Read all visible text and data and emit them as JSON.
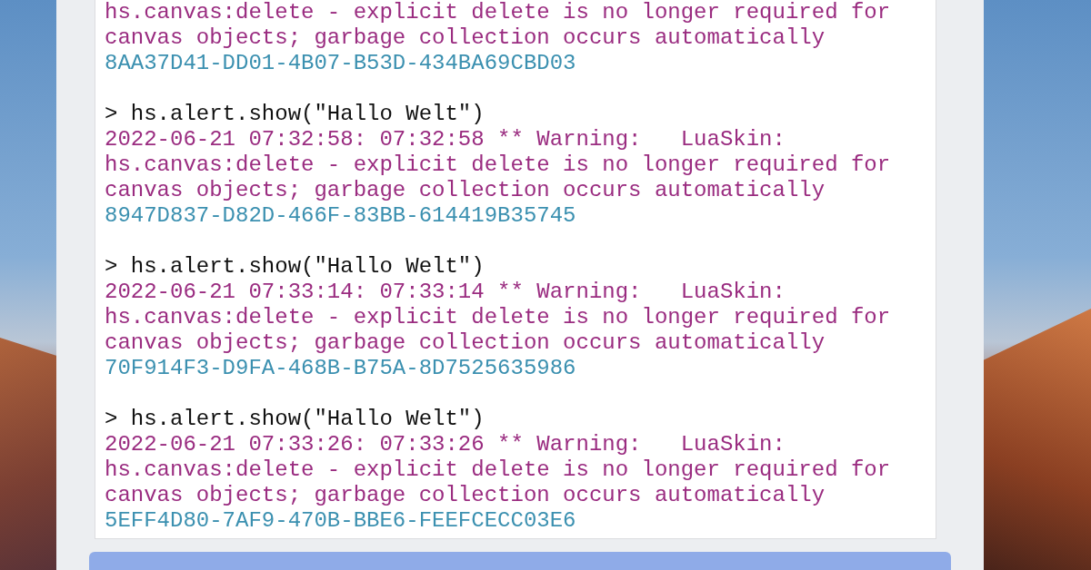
{
  "console": {
    "blocks": [
      {
        "lines": [
          {
            "kind": "warning",
            "text": "hs.canvas:delete - explicit delete is no longer required for"
          },
          {
            "kind": "warning",
            "text": "canvas objects; garbage collection occurs automatically"
          },
          {
            "kind": "id",
            "text": "8AA37D41-DD01-4B07-B53D-434BA69CBD03"
          }
        ]
      },
      {
        "lines": [
          {
            "kind": "command",
            "text": "> hs.alert.show(\"Hallo Welt\")"
          },
          {
            "kind": "warning",
            "text": "2022-06-21 07:32:58: 07:32:58 ** Warning:   LuaSkin:"
          },
          {
            "kind": "warning",
            "text": "hs.canvas:delete - explicit delete is no longer required for"
          },
          {
            "kind": "warning",
            "text": "canvas objects; garbage collection occurs automatically"
          },
          {
            "kind": "id",
            "text": "8947D837-D82D-466F-83BB-614419B35745"
          }
        ]
      },
      {
        "lines": [
          {
            "kind": "command",
            "text": "> hs.alert.show(\"Hallo Welt\")"
          },
          {
            "kind": "warning",
            "text": "2022-06-21 07:33:14: 07:33:14 ** Warning:   LuaSkin:"
          },
          {
            "kind": "warning",
            "text": "hs.canvas:delete - explicit delete is no longer required for"
          },
          {
            "kind": "warning",
            "text": "canvas objects; garbage collection occurs automatically"
          },
          {
            "kind": "id",
            "text": "70F914F3-D9FA-468B-B75A-8D7525635986"
          }
        ]
      },
      {
        "lines": [
          {
            "kind": "command",
            "text": "> hs.alert.show(\"Hallo Welt\")"
          },
          {
            "kind": "warning",
            "text": "2022-06-21 07:33:26: 07:33:26 ** Warning:   LuaSkin:"
          },
          {
            "kind": "warning",
            "text": "hs.canvas:delete - explicit delete is no longer required for"
          },
          {
            "kind": "warning",
            "text": "canvas objects; garbage collection occurs automatically"
          },
          {
            "kind": "id",
            "text": "5EFF4D80-7AF9-470B-BBE6-FEEFCECC03E6"
          }
        ]
      }
    ]
  }
}
